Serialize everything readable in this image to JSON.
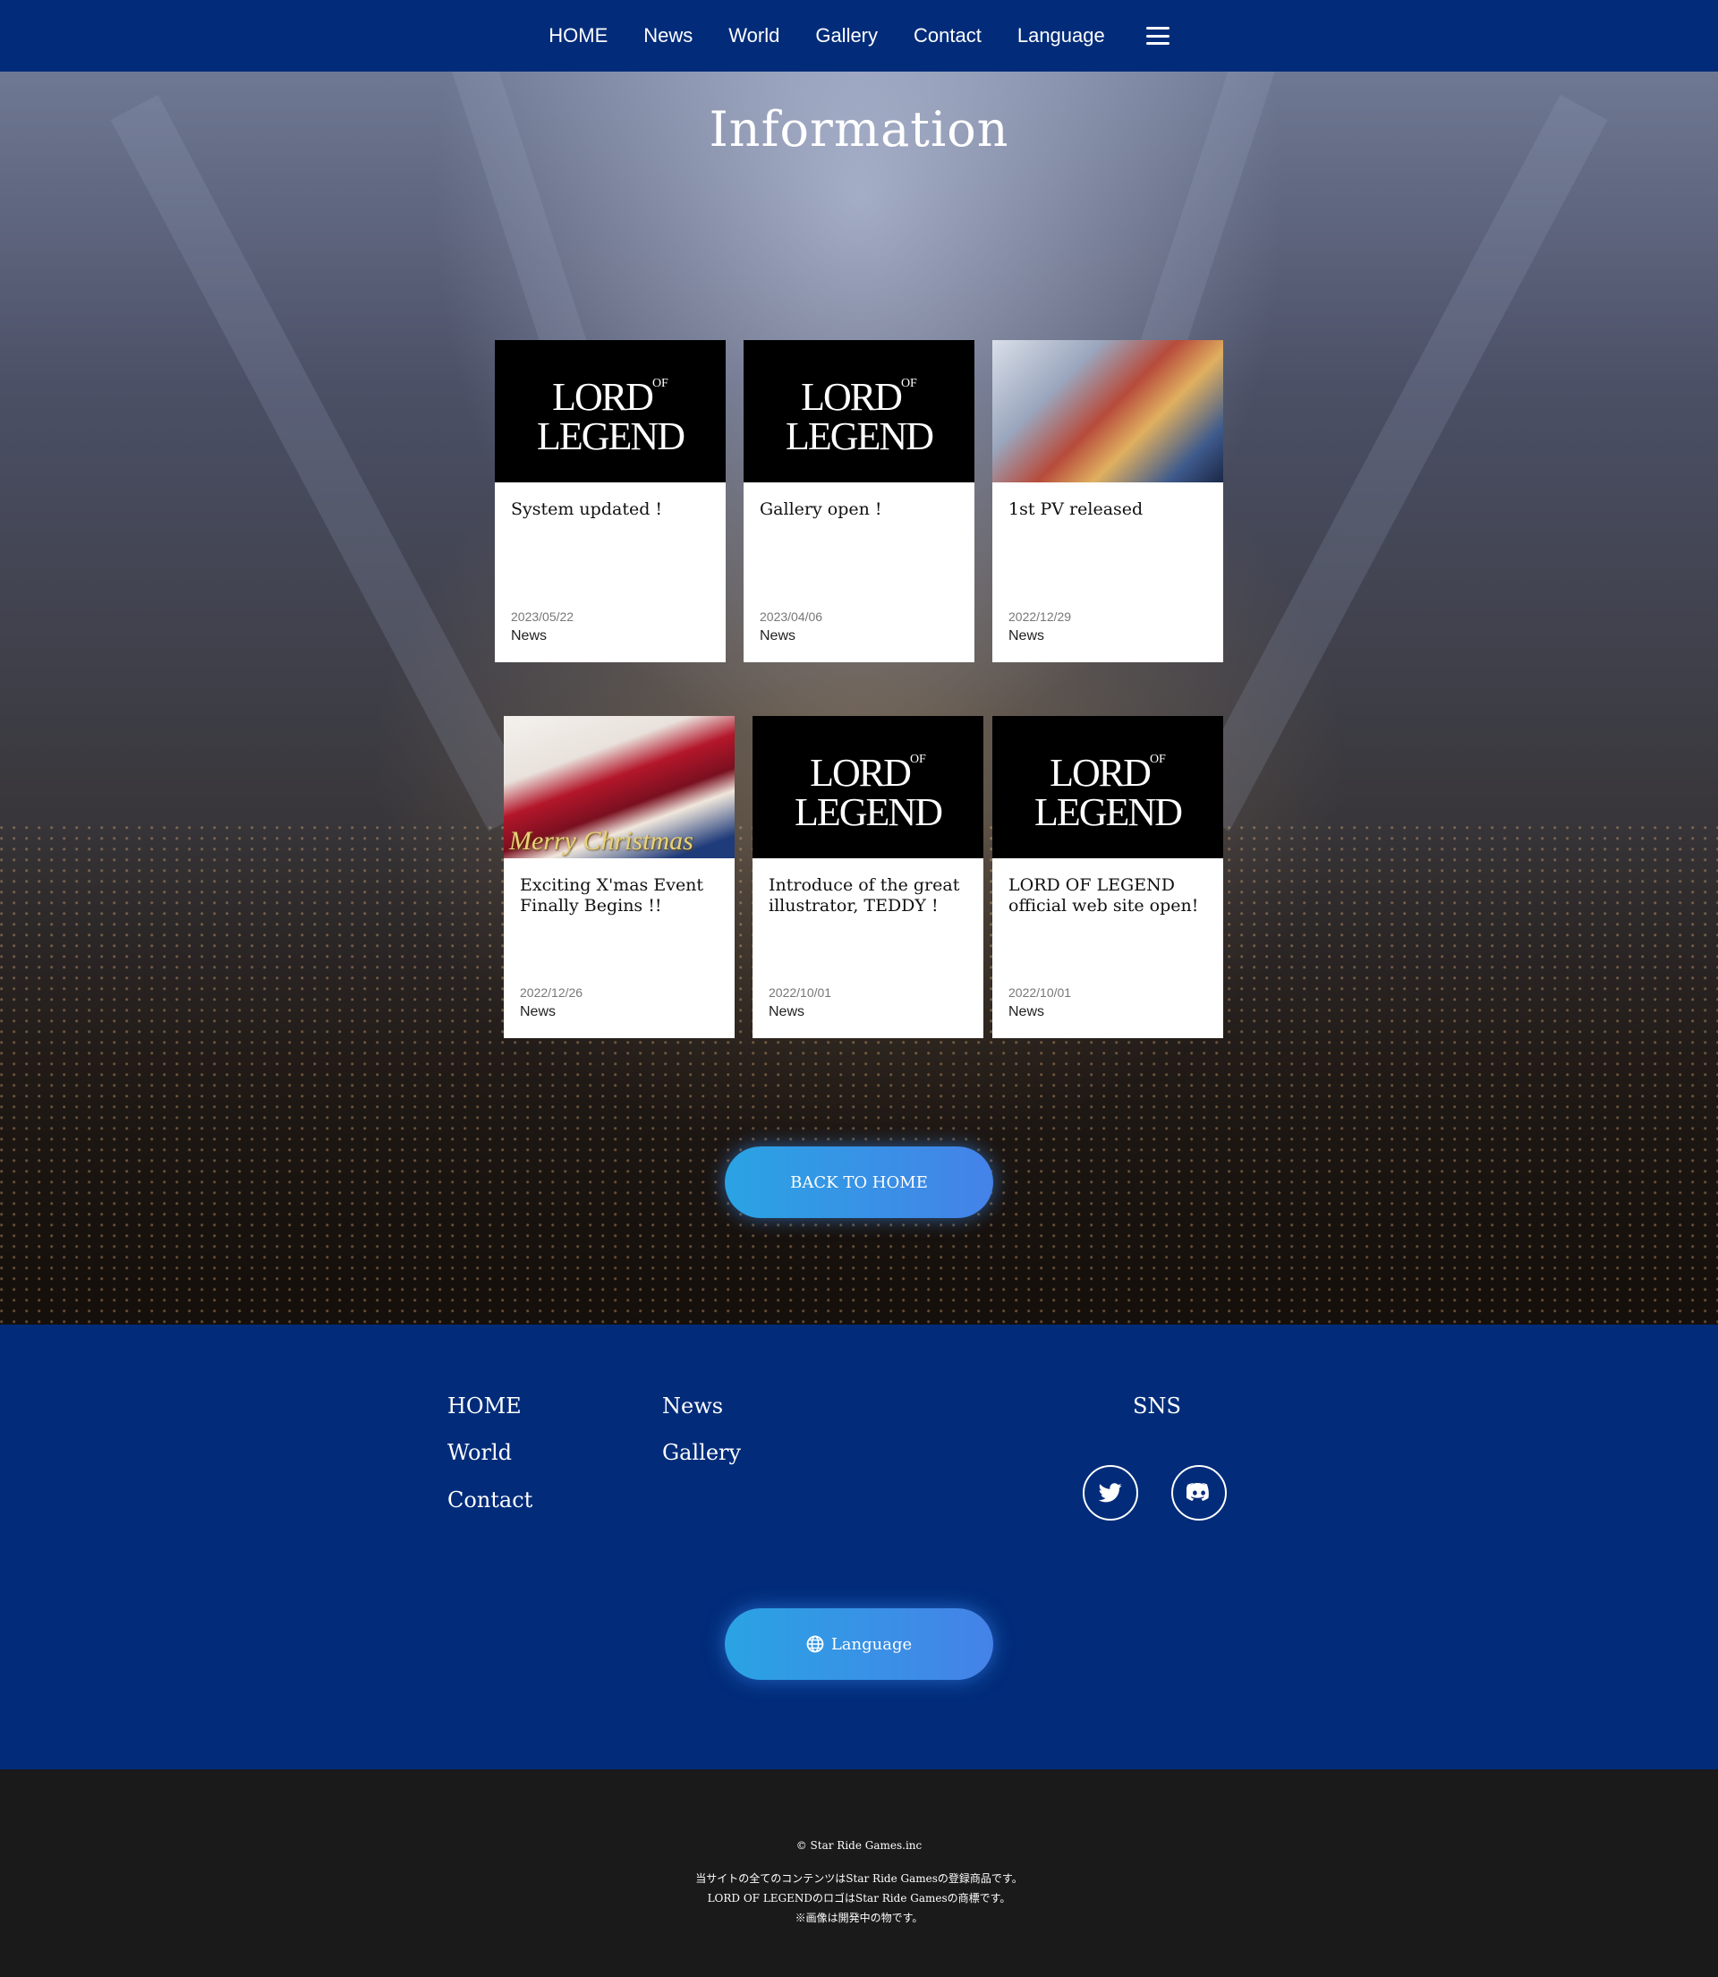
{
  "nav": {
    "items": [
      "HOME",
      "News",
      "World",
      "Gallery",
      "Contact",
      "Language"
    ]
  },
  "hero": {
    "title": "Information"
  },
  "cards": [
    {
      "title": "System updated !",
      "date": "2023/05/22",
      "category": "News",
      "thumb": "logo"
    },
    {
      "title": "Gallery open !",
      "date": "2023/04/06",
      "category": "News",
      "thumb": "logo"
    },
    {
      "title": "1st PV released",
      "date": "2022/12/29",
      "category": "News",
      "thumb": "key-art"
    },
    {
      "title": "Exciting X'mas Event Finally Begins !!",
      "date": "2022/12/26",
      "category": "News",
      "thumb": "christmas-art",
      "art_text": "Merry Christmas"
    },
    {
      "title": "Introduce of the great illustrator, TEDDY !",
      "date": "2022/10/01",
      "category": "News",
      "thumb": "logo"
    },
    {
      "title": "LORD OF LEGEND official web site open!",
      "date": "2022/10/01",
      "category": "News",
      "thumb": "logo"
    }
  ],
  "logo_text": {
    "main": "LORD",
    "of": "OF",
    "second": "LEGEND"
  },
  "back_button": "BACK TO HOME",
  "footer": {
    "links_col1": [
      "HOME",
      "World",
      "Contact"
    ],
    "links_col2": [
      "News",
      "Gallery"
    ],
    "sns_title": "SNS",
    "sns_icons": [
      "twitter-icon",
      "discord-icon"
    ],
    "language_button": "Language"
  },
  "bottom": {
    "copyright": "© Star Ride Games.inc",
    "note1": "当サイトの全てのコンテンツはStar Ride Gamesの登録商品です。",
    "note2": "LORD OF LEGENDのロゴはStar Ride Gamesの商標です。",
    "note3": "※画像は開発中の物です。"
  },
  "colors": {
    "nav_bg": "#022c7a",
    "bottom_bg": "#1a1a1a",
    "button_from": "#2aa3e3",
    "button_to": "#4582e8"
  }
}
